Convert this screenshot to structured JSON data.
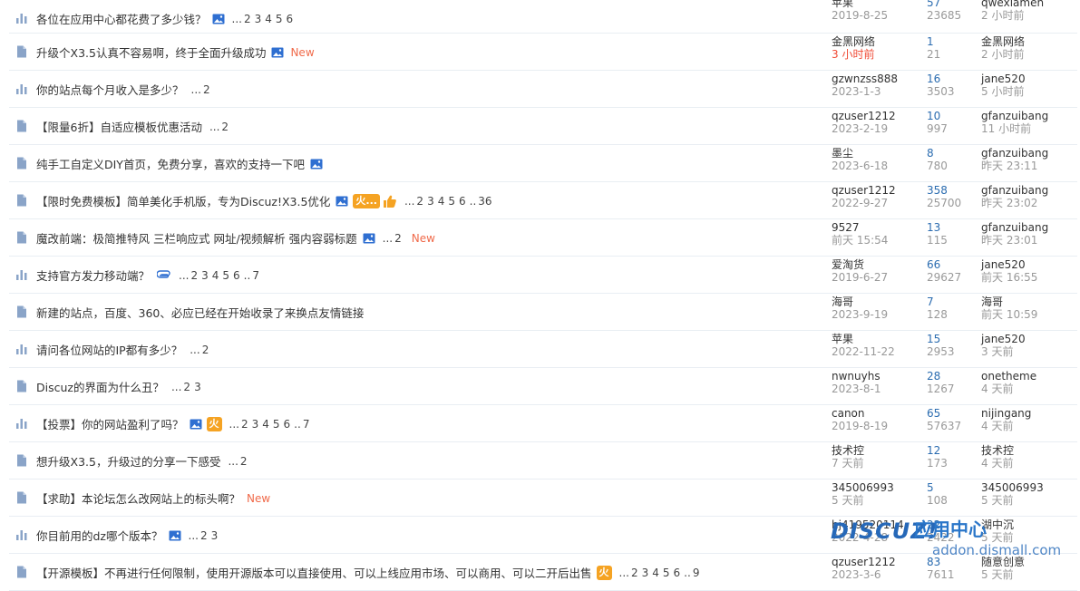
{
  "threads": [
    {
      "icon": "poll-icon",
      "title": "各位在应用中心都花费了多少钱？",
      "img": true,
      "hot": false,
      "thumb": false,
      "clip": false,
      "pages": [
        "...",
        "2",
        "3",
        "4",
        "5",
        "6"
      ],
      "new": "",
      "author": "苹果",
      "date": "2019-8-25",
      "date_red": false,
      "replies": "57",
      "views": "23685",
      "last": "qwexiamen",
      "last_time": "2 小时前"
    },
    {
      "icon": "doc-icon",
      "title": "升级个X3.5认真不容易啊，终于全面升级成功",
      "img": true,
      "hot": false,
      "thumb": false,
      "clip": false,
      "pages": [],
      "new": "New",
      "author": "金黑网络",
      "date": "3 小时前",
      "date_red": true,
      "replies": "1",
      "views": "21",
      "last": "金黑网络",
      "last_time": "2 小时前"
    },
    {
      "icon": "poll-icon",
      "title": "你的站点每个月收入是多少？",
      "img": false,
      "hot": false,
      "thumb": false,
      "clip": false,
      "pages": [
        "...",
        "2"
      ],
      "new": "",
      "author": "gzwnzss888",
      "date": "2023-1-3",
      "date_red": false,
      "replies": "16",
      "views": "3503",
      "last": "jane520",
      "last_time": "5 小时前"
    },
    {
      "icon": "doc-icon",
      "title": "【限量6折】自适应模板优惠活动",
      "img": false,
      "hot": false,
      "thumb": false,
      "clip": false,
      "pages": [
        "...",
        "2"
      ],
      "new": "",
      "author": "qzuser1212",
      "date": "2023-2-19",
      "date_red": false,
      "replies": "10",
      "views": "997",
      "last": "gfanzuibang",
      "last_time": "11 小时前"
    },
    {
      "icon": "doc-icon",
      "title": "纯手工自定义DIY首页，免费分享，喜欢的支持一下吧",
      "img": true,
      "hot": false,
      "thumb": false,
      "clip": false,
      "pages": [],
      "new": "",
      "author": "墨尘",
      "date": "2023-6-18",
      "date_red": false,
      "replies": "8",
      "views": "780",
      "last": "gfanzuibang",
      "last_time": "昨天 23:11"
    },
    {
      "icon": "doc-icon",
      "title": "【限时免费模板】简单美化手机版，专为Discuz!X3.5优化",
      "img": true,
      "hot": true,
      "hot_text": "火...",
      "thumb": true,
      "clip": false,
      "pages": [
        "...",
        "2",
        "3",
        "4",
        "5",
        "6",
        "..",
        "36"
      ],
      "new": "",
      "author": "qzuser1212",
      "date": "2022-9-27",
      "date_red": false,
      "replies": "358",
      "views": "25700",
      "last": "gfanzuibang",
      "last_time": "昨天 23:02"
    },
    {
      "icon": "doc-icon",
      "title": "魔改前端：极简推特风 三栏响应式 网址/视频解析 强内容弱标题",
      "img": true,
      "hot": false,
      "thumb": false,
      "clip": false,
      "pages": [
        "...",
        "2"
      ],
      "new": "New",
      "author": "9527",
      "date": "前天 15:54",
      "date_red": false,
      "replies": "13",
      "views": "115",
      "last": "gfanzuibang",
      "last_time": "昨天 23:01"
    },
    {
      "icon": "poll-icon",
      "title": "支持官方发力移动端？",
      "img": false,
      "hot": false,
      "thumb": false,
      "clip": true,
      "pages": [
        "...",
        "2",
        "3",
        "4",
        "5",
        "6",
        "..",
        "7"
      ],
      "new": "",
      "author": "爱淘货",
      "date": "2019-6-27",
      "date_red": false,
      "replies": "66",
      "views": "29627",
      "last": "jane520",
      "last_time": "前天 16:55"
    },
    {
      "icon": "doc-icon",
      "title": "新建的站点，百度、360、必应已经在开始收录了来换点友情链接",
      "img": false,
      "hot": false,
      "thumb": false,
      "clip": false,
      "pages": [],
      "new": "",
      "author": "海哥",
      "date": "2023-9-19",
      "date_red": false,
      "replies": "7",
      "views": "128",
      "last": "海哥",
      "last_time": "前天 10:59"
    },
    {
      "icon": "poll-icon",
      "title": "请问各位网站的IP都有多少？",
      "img": false,
      "hot": false,
      "thumb": false,
      "clip": false,
      "pages": [
        "...",
        "2"
      ],
      "new": "",
      "author": "苹果",
      "date": "2022-11-22",
      "date_red": false,
      "replies": "15",
      "views": "2953",
      "last": "jane520",
      "last_time": "3 天前"
    },
    {
      "icon": "doc-icon",
      "title": "Discuz的界面为什么丑？",
      "img": false,
      "hot": false,
      "thumb": false,
      "clip": false,
      "pages": [
        "...",
        "2",
        "3"
      ],
      "new": "",
      "author": "nwnuyhs",
      "date": "2023-8-1",
      "date_red": false,
      "replies": "28",
      "views": "1267",
      "last": "onetheme",
      "last_time": "4 天前"
    },
    {
      "icon": "poll-icon",
      "title": "【投票】你的网站盈利了吗？",
      "img": true,
      "hot": true,
      "hot_text": "火",
      "thumb": false,
      "clip": false,
      "pages": [
        "...",
        "2",
        "3",
        "4",
        "5",
        "6",
        "..",
        "7"
      ],
      "new": "",
      "author": "canon",
      "date": "2019-8-19",
      "date_red": false,
      "replies": "65",
      "views": "57637",
      "last": "nijingang",
      "last_time": "4 天前"
    },
    {
      "icon": "doc-icon",
      "title": "想升级X3.5，升级过的分享一下感受",
      "img": false,
      "hot": false,
      "thumb": false,
      "clip": false,
      "pages": [
        "...",
        "2"
      ],
      "new": "",
      "author": "技术控",
      "date": "7 天前",
      "date_red": false,
      "replies": "12",
      "views": "173",
      "last": "技术控",
      "last_time": "4 天前"
    },
    {
      "icon": "doc-icon",
      "title": "【求助】本论坛怎么改网站上的标头啊？",
      "img": false,
      "hot": false,
      "thumb": false,
      "clip": false,
      "pages": [],
      "new": "New",
      "author": "345006993",
      "date": "5 天前",
      "date_red": false,
      "replies": "5",
      "views": "108",
      "last": "345006993",
      "last_time": "5 天前"
    },
    {
      "icon": "poll-icon",
      "title": "你目前用的dz哪个版本？",
      "img": true,
      "hot": false,
      "thumb": false,
      "clip": false,
      "pages": [
        "...",
        "2",
        "3"
      ],
      "new": "",
      "author": "hj419520114",
      "date": "2022-4-28",
      "date_red": false,
      "replies": "22",
      "views": "2422",
      "last": "湖中沉",
      "last_time": "5 天前"
    },
    {
      "icon": "doc-icon",
      "title": "【开源模板】不再进行任何限制，使用开源版本可以直接使用、可以上线应用市场、可以商用、可以二开后出售",
      "img": false,
      "hot": true,
      "hot_text": "火",
      "thumb": false,
      "clip": false,
      "pages": [
        "...",
        "2",
        "3",
        "4",
        "5",
        "6",
        "..",
        "9"
      ],
      "new": "",
      "author": "qzuser1212",
      "date": "2023-3-6",
      "date_red": false,
      "replies": "83",
      "views": "7611",
      "last": "随意创意",
      "last_time": "5 天前"
    }
  ],
  "watermark": {
    "logo": "DISCUZ!",
    "sub": "应用中心",
    "url": "addon.dismall.com"
  },
  "colors": {
    "accent": "#2b6cb0",
    "new": "#f06a4a",
    "hot": "#f5a323",
    "icon": "#8aa4c8",
    "red_date": "#f04b36"
  }
}
